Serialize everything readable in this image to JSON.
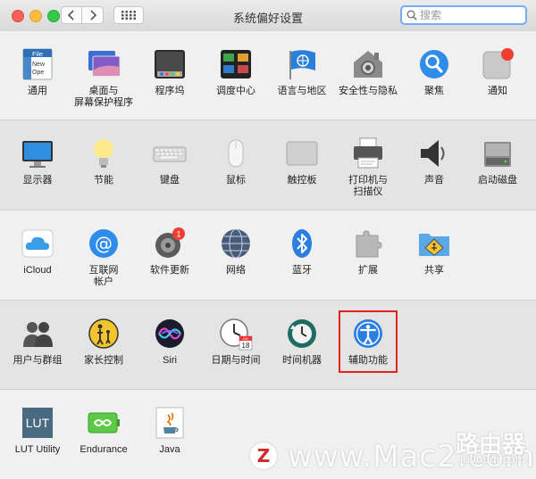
{
  "window": {
    "title": "系统偏好设置",
    "search_placeholder": "搜索"
  },
  "rows": [
    [
      {
        "label": "通用",
        "icon": "general-icon"
      },
      {
        "label": "桌面与\n屏幕保护程序",
        "icon": "desktop-screensaver-icon"
      },
      {
        "label": "程序坞",
        "icon": "dock-icon"
      },
      {
        "label": "调度中心",
        "icon": "mission-control-icon"
      },
      {
        "label": "语言与地区",
        "icon": "language-region-icon"
      },
      {
        "label": "安全性与隐私",
        "icon": "security-privacy-icon"
      },
      {
        "label": "聚焦",
        "icon": "spotlight-icon"
      },
      {
        "label": "通知",
        "icon": "notifications-icon"
      }
    ],
    [
      {
        "label": "显示器",
        "icon": "displays-icon"
      },
      {
        "label": "节能",
        "icon": "energy-saver-icon"
      },
      {
        "label": "键盘",
        "icon": "keyboard-icon"
      },
      {
        "label": "鼠标",
        "icon": "mouse-icon"
      },
      {
        "label": "触控板",
        "icon": "trackpad-icon"
      },
      {
        "label": "打印机与\n扫描仪",
        "icon": "printers-scanners-icon"
      },
      {
        "label": "声音",
        "icon": "sound-icon"
      },
      {
        "label": "启动磁盘",
        "icon": "startup-disk-icon"
      }
    ],
    [
      {
        "label": "iCloud",
        "icon": "icloud-icon"
      },
      {
        "label": "互联网\n帐户",
        "icon": "internet-accounts-icon"
      },
      {
        "label": "软件更新",
        "icon": "software-update-icon",
        "badge": "1"
      },
      {
        "label": "网络",
        "icon": "network-icon"
      },
      {
        "label": "蓝牙",
        "icon": "bluetooth-icon"
      },
      {
        "label": "扩展",
        "icon": "extensions-icon"
      },
      {
        "label": "共享",
        "icon": "sharing-icon"
      }
    ],
    [
      {
        "label": "用户与群组",
        "icon": "users-groups-icon"
      },
      {
        "label": "家长控制",
        "icon": "parental-controls-icon"
      },
      {
        "label": "Siri",
        "icon": "siri-icon"
      },
      {
        "label": "日期与时间",
        "icon": "date-time-icon",
        "calendar_month": "JUL",
        "calendar_day": "18"
      },
      {
        "label": "时间机器",
        "icon": "time-machine-icon"
      },
      {
        "label": "辅助功能",
        "icon": "accessibility-icon",
        "highlighted": true
      }
    ],
    [
      {
        "label": "LUT Utility",
        "icon": "lut-utility-icon",
        "icon_text": "LUT"
      },
      {
        "label": "Endurance",
        "icon": "endurance-icon"
      },
      {
        "label": "Java",
        "icon": "java-icon"
      }
    ]
  ],
  "general_icon_text": {
    "line1": "File",
    "line2": "New",
    "line3": "Ope"
  },
  "watermark": {
    "text": "www.Mac2.com",
    "logo": "Z",
    "router": "路由器",
    "router_sub": "luyouqi.com"
  }
}
